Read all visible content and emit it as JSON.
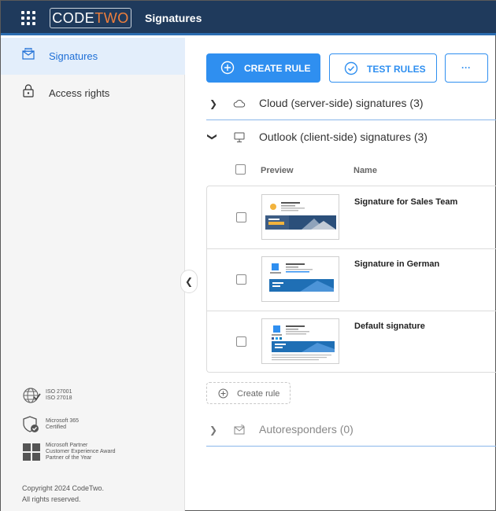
{
  "app": {
    "brand_code": "CODE",
    "brand_two": "TWO",
    "title": "Signatures"
  },
  "sidebar": {
    "items": [
      {
        "label": "Signatures",
        "icon": "envelope-signature-icon",
        "active": true
      },
      {
        "label": "Access rights",
        "icon": "lock-icon",
        "active": false
      }
    ],
    "badges": [
      {
        "icon": "iso-globe-icon",
        "line1": "ISO 27001",
        "line2": "ISO 27018",
        "line3": ""
      },
      {
        "icon": "shield-check-icon",
        "line1": "Microsoft 365",
        "line2": "Certified",
        "line3": ""
      },
      {
        "icon": "microsoft-logo-icon",
        "line1": "Microsoft Partner",
        "line2": "Customer Experience Award",
        "line3": "Partner of the Year"
      }
    ],
    "copyright_line1": "Copyright 2024 CodeTwo.",
    "copyright_line2": "All rights reserved."
  },
  "toolbar": {
    "create_rule": "CREATE RULE",
    "test_rules": "TEST RULES",
    "more": "···"
  },
  "sections": {
    "cloud": {
      "title": "Cloud (server-side) signatures (3)",
      "expanded": false
    },
    "outlook": {
      "title": "Outlook (client-side) signatures (3)",
      "expanded": true
    },
    "autoresponders": {
      "title": "Autoresponders (0)",
      "expanded": false
    }
  },
  "table": {
    "col_preview": "Preview",
    "col_name": "Name",
    "rows": [
      {
        "name": "Signature for Sales Team"
      },
      {
        "name": "Signature in German"
      },
      {
        "name": "Default signature"
      }
    ]
  },
  "add_rule": "Create rule",
  "colors": {
    "topbar": "#1f3a5c",
    "accent": "#2f8ff0",
    "brand_orange": "#f07f3c",
    "active_nav_bg": "#e3eefb"
  }
}
